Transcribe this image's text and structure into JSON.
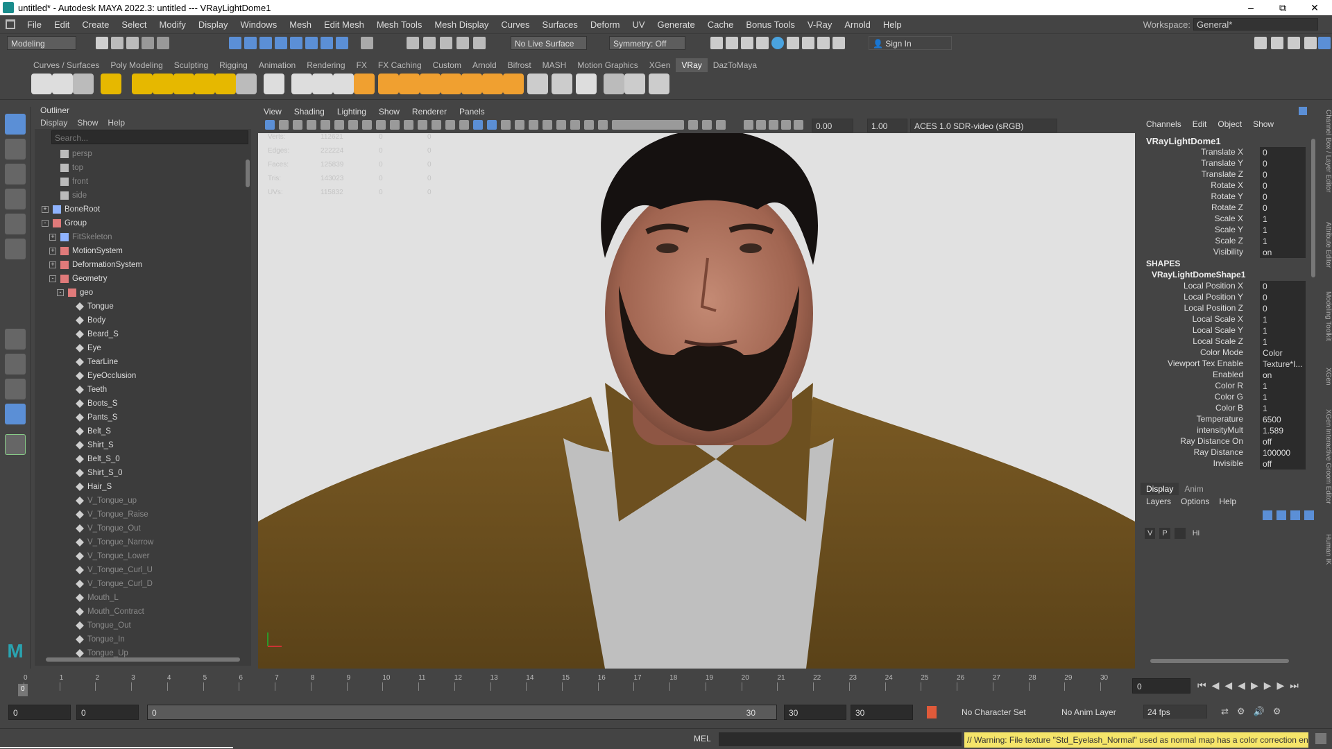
{
  "window": {
    "title": "untitled* - Autodesk MAYA 2022.3: untitled   ---   VRayLightDome1"
  },
  "menubar": [
    "File",
    "Edit",
    "Create",
    "Select",
    "Modify",
    "Display",
    "Windows",
    "Mesh",
    "Edit Mesh",
    "Mesh Tools",
    "Mesh Display",
    "Curves",
    "Surfaces",
    "Deform",
    "UV",
    "Generate",
    "Cache",
    "Bonus Tools",
    "V-Ray",
    "Arnold",
    "Help"
  ],
  "workspace": {
    "label": "Workspace:",
    "value": "General*"
  },
  "statusline": {
    "mode": "Modeling",
    "live_surface": "No Live Surface",
    "symmetry": "Symmetry: Off",
    "sign_in": "Sign In"
  },
  "shelf_tabs": [
    "Curves / Surfaces",
    "Poly Modeling",
    "Sculpting",
    "Rigging",
    "Animation",
    "Rendering",
    "FX",
    "FX Caching",
    "Custom",
    "Arnold",
    "Bifrost",
    "MASH",
    "Motion Graphics",
    "XGen",
    "VRay",
    "DazToMaya"
  ],
  "shelf_active": "VRay",
  "outliner": {
    "title": "Outliner",
    "menu": [
      "Display",
      "Show",
      "Help"
    ],
    "search_placeholder": "Search...",
    "items": [
      {
        "label": "persp",
        "depth": 1,
        "dim": true,
        "icon": "camera"
      },
      {
        "label": "top",
        "depth": 1,
        "dim": true,
        "icon": "camera"
      },
      {
        "label": "front",
        "depth": 1,
        "dim": true,
        "icon": "camera"
      },
      {
        "label": "side",
        "depth": 1,
        "dim": true,
        "icon": "camera"
      },
      {
        "label": "BoneRoot",
        "depth": 0,
        "dim": false,
        "icon": "joint",
        "exp": "+"
      },
      {
        "label": "Group",
        "depth": 0,
        "dim": false,
        "icon": "group",
        "exp": "-"
      },
      {
        "label": "FitSkeleton",
        "depth": 1,
        "dim": true,
        "icon": "joint",
        "exp": "+"
      },
      {
        "label": "MotionSystem",
        "depth": 1,
        "dim": false,
        "icon": "group",
        "exp": "+"
      },
      {
        "label": "DeformationSystem",
        "depth": 1,
        "dim": false,
        "icon": "group",
        "exp": "+"
      },
      {
        "label": "Geometry",
        "depth": 1,
        "dim": false,
        "icon": "group",
        "exp": "-"
      },
      {
        "label": "geo",
        "depth": 2,
        "dim": false,
        "icon": "group",
        "exp": "-"
      },
      {
        "label": "Tongue",
        "depth": 3,
        "dim": false,
        "icon": "mesh"
      },
      {
        "label": "Body",
        "depth": 3,
        "dim": false,
        "icon": "mesh"
      },
      {
        "label": "Beard_S",
        "depth": 3,
        "dim": false,
        "icon": "mesh"
      },
      {
        "label": "Eye",
        "depth": 3,
        "dim": false,
        "icon": "mesh"
      },
      {
        "label": "TearLine",
        "depth": 3,
        "dim": false,
        "icon": "mesh"
      },
      {
        "label": "EyeOcclusion",
        "depth": 3,
        "dim": false,
        "icon": "mesh"
      },
      {
        "label": "Teeth",
        "depth": 3,
        "dim": false,
        "icon": "mesh"
      },
      {
        "label": "Boots_S",
        "depth": 3,
        "dim": false,
        "icon": "mesh"
      },
      {
        "label": "Pants_S",
        "depth": 3,
        "dim": false,
        "icon": "mesh"
      },
      {
        "label": "Belt_S",
        "depth": 3,
        "dim": false,
        "icon": "mesh"
      },
      {
        "label": "Shirt_S",
        "depth": 3,
        "dim": false,
        "icon": "mesh"
      },
      {
        "label": "Belt_S_0",
        "depth": 3,
        "dim": false,
        "icon": "mesh"
      },
      {
        "label": "Shirt_S_0",
        "depth": 3,
        "dim": false,
        "icon": "mesh"
      },
      {
        "label": "Hair_S",
        "depth": 3,
        "dim": false,
        "icon": "mesh"
      },
      {
        "label": "V_Tongue_up",
        "depth": 3,
        "dim": true,
        "icon": "mesh"
      },
      {
        "label": "V_Tongue_Raise",
        "depth": 3,
        "dim": true,
        "icon": "mesh"
      },
      {
        "label": "V_Tongue_Out",
        "depth": 3,
        "dim": true,
        "icon": "mesh"
      },
      {
        "label": "V_Tongue_Narrow",
        "depth": 3,
        "dim": true,
        "icon": "mesh"
      },
      {
        "label": "V_Tongue_Lower",
        "depth": 3,
        "dim": true,
        "icon": "mesh"
      },
      {
        "label": "V_Tongue_Curl_U",
        "depth": 3,
        "dim": true,
        "icon": "mesh"
      },
      {
        "label": "V_Tongue_Curl_D",
        "depth": 3,
        "dim": true,
        "icon": "mesh"
      },
      {
        "label": "Mouth_L",
        "depth": 3,
        "dim": true,
        "icon": "mesh"
      },
      {
        "label": "Mouth_Contract",
        "depth": 3,
        "dim": true,
        "icon": "mesh"
      },
      {
        "label": "Tongue_Out",
        "depth": 3,
        "dim": true,
        "icon": "mesh"
      },
      {
        "label": "Tongue_In",
        "depth": 3,
        "dim": true,
        "icon": "mesh"
      },
      {
        "label": "Tongue_Up",
        "depth": 3,
        "dim": true,
        "icon": "mesh"
      }
    ]
  },
  "viewport": {
    "menu": [
      "View",
      "Shading",
      "Lighting",
      "Show",
      "Renderer",
      "Panels"
    ],
    "gamma": "0.00",
    "exposure": "1.00",
    "colorspace": "ACES 1.0 SDR-video (sRGB)",
    "hud": [
      {
        "label": "Verts:",
        "v1": "112621",
        "v2": "0",
        "v3": "0"
      },
      {
        "label": "Edges:",
        "v1": "222224",
        "v2": "0",
        "v3": "0"
      },
      {
        "label": "Faces:",
        "v1": "125839",
        "v2": "0",
        "v3": "0"
      },
      {
        "label": "Tris:",
        "v1": "143023",
        "v2": "0",
        "v3": "0"
      },
      {
        "label": "UVs:",
        "v1": "115832",
        "v2": "0",
        "v3": "0"
      }
    ]
  },
  "channelbox": {
    "menu": [
      "Channels",
      "Edit",
      "Object",
      "Show"
    ],
    "node": "VRayLightDome1",
    "attrs": [
      {
        "name": "Translate X",
        "value": "0"
      },
      {
        "name": "Translate Y",
        "value": "0"
      },
      {
        "name": "Translate Z",
        "value": "0"
      },
      {
        "name": "Rotate X",
        "value": "0"
      },
      {
        "name": "Rotate Y",
        "value": "0"
      },
      {
        "name": "Rotate Z",
        "value": "0"
      },
      {
        "name": "Scale X",
        "value": "1"
      },
      {
        "name": "Scale Y",
        "value": "1"
      },
      {
        "name": "Scale Z",
        "value": "1"
      },
      {
        "name": "Visibility",
        "value": "on"
      }
    ],
    "shapes_label": "SHAPES",
    "shape_node": "VRayLightDomeShape1",
    "shape_attrs": [
      {
        "name": "Local Position X",
        "value": "0"
      },
      {
        "name": "Local Position Y",
        "value": "0"
      },
      {
        "name": "Local Position Z",
        "value": "0"
      },
      {
        "name": "Local Scale X",
        "value": "1"
      },
      {
        "name": "Local Scale Y",
        "value": "1"
      },
      {
        "name": "Local Scale Z",
        "value": "1"
      },
      {
        "name": "Color Mode",
        "value": "Color"
      },
      {
        "name": "Viewport Tex Enable",
        "value": "Texture*I..."
      },
      {
        "name": "Enabled",
        "value": "on"
      },
      {
        "name": "Color R",
        "value": "1"
      },
      {
        "name": "Color G",
        "value": "1"
      },
      {
        "name": "Color B",
        "value": "1"
      },
      {
        "name": "Temperature",
        "value": "6500"
      },
      {
        "name": "intensityMult",
        "value": "1.589"
      },
      {
        "name": "Ray Distance On",
        "value": "off"
      },
      {
        "name": "Ray Distance",
        "value": "100000"
      },
      {
        "name": "Invisible",
        "value": "off"
      }
    ]
  },
  "side_tabs": [
    "Channel Box / Layer Editor",
    "Attribute Editor",
    "Modeling Toolkit",
    "XGen",
    "XGen Interactive Groom Editor",
    "Human IK"
  ],
  "layers": {
    "tabs": [
      "Display",
      "Anim"
    ],
    "menu": [
      "Layers",
      "Options",
      "Help"
    ],
    "row": {
      "v": "V",
      "p": "P",
      "name": "Hi"
    }
  },
  "timeline": {
    "ticks": [
      "0",
      "1",
      "2",
      "3",
      "4",
      "5",
      "6",
      "7",
      "8",
      "9",
      "10",
      "11",
      "12",
      "13",
      "14",
      "15",
      "16",
      "17",
      "18",
      "19",
      "20",
      "21",
      "22",
      "23",
      "24",
      "25",
      "26",
      "27",
      "28",
      "29",
      "30"
    ],
    "current": "0",
    "current_field": "0"
  },
  "range": {
    "start": "0",
    "anim_start": "0",
    "slider_start": "0",
    "slider_end": "30",
    "end": "30",
    "anim_end": "30",
    "char_set": "No Character Set",
    "anim_layer": "No Anim Layer",
    "fps": "24 fps"
  },
  "cmdline": {
    "lang": "MEL",
    "warning": "// Warning: File texture \"Std_Eyelash_Normal\" used as normal map has a color correction enabled."
  }
}
